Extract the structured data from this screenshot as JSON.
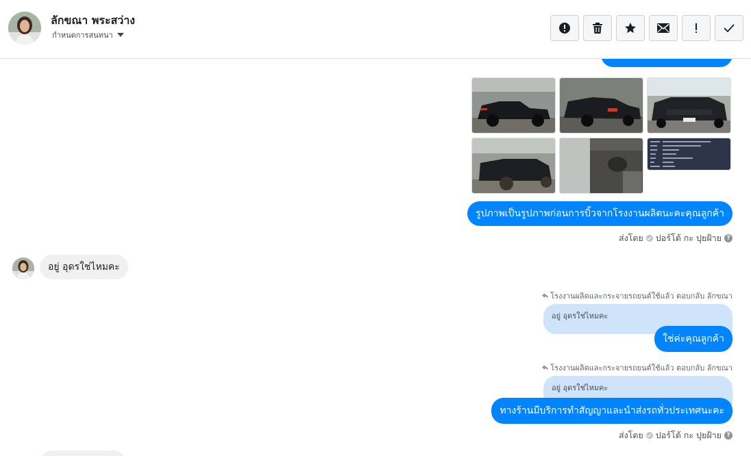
{
  "header": {
    "contact_name": "ลักขณา พระสว่าง",
    "assign_label": "กำหนดการสนทนา",
    "toolbar": [
      {
        "name": "report-icon-button",
        "icon": "alert-circle-icon"
      },
      {
        "name": "delete-button",
        "icon": "trash-icon"
      },
      {
        "name": "star-button",
        "icon": "star-icon"
      },
      {
        "name": "mark-unread-button",
        "icon": "envelope-icon"
      },
      {
        "name": "spam-button",
        "icon": "exclamation-icon"
      },
      {
        "name": "mark-done-button",
        "icon": "check-icon"
      }
    ]
  },
  "messages": {
    "photos_caption": "รูปภาพเป็นรูปภาพก่อนการบิ้วจากโรงงานผลิตนะคะคุณลูกค้า",
    "sent_by_label": "ส่งโดย",
    "sent_by_name": "ปอร์โต้ กะ ปุยฝ้าย",
    "incoming_text": "อยู่ อุดรใช่ไหมคะ",
    "reply1_meta": "โรงงานผลิตและกระจายรถยนต์ใช้แล้ว ตอบกลับ ลักขณา",
    "reply1_quote": "อยู่ อุดรใช่ไหมคะ",
    "reply1_text": "ใช่ค่ะคุณลูกค้า",
    "reply2_meta": "โรงงานผลิตและกระจายรถยนต์ใช้แล้ว ตอบกลับ ลักขณา",
    "reply2_quote": "อยู่ อุดรใช่ไหมคะ",
    "reply2_text": "ทางร้านมีบริการทำสัญญาและนำส่งรถทั่วประเทศนะคะ",
    "sent_by2_label": "ส่งโดย",
    "sent_by2_name": "ปอร์โต้ กะ ปุยฝ้าย"
  },
  "colors": {
    "outgoing_bubble": "#0084ff",
    "incoming_bubble": "#f1f0f0",
    "quoted_bubble": "#cfe3fb"
  }
}
